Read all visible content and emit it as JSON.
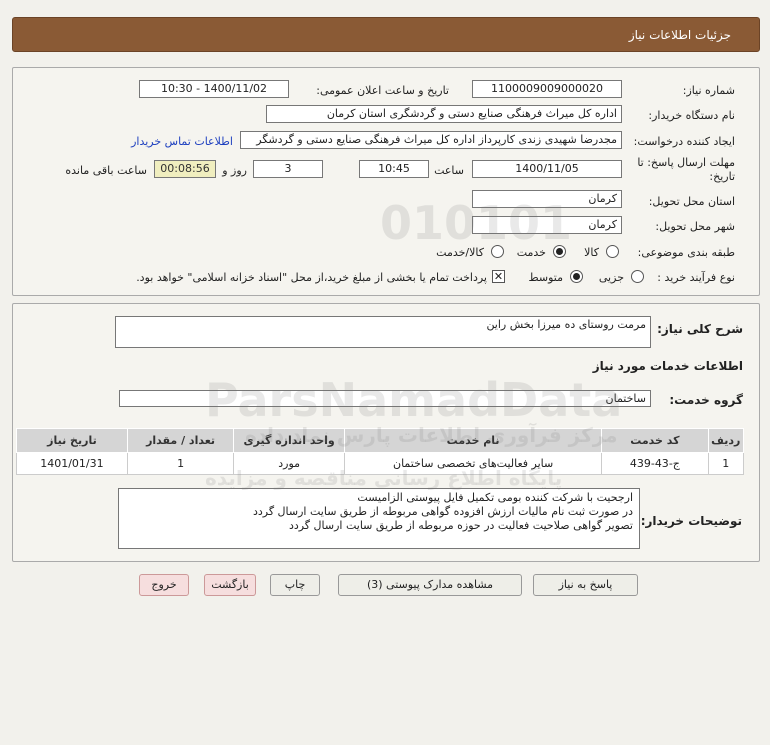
{
  "header": {
    "title": "جزئیات اطلاعات نیاز"
  },
  "form": {
    "need_number_label": "شماره نیاز:",
    "need_number": "1100009009000020",
    "announce_label": "تاریخ و ساعت اعلان عمومی:",
    "announce_value": "1400/11/02 - 10:30",
    "buyer_org_label": "نام دستگاه خریدار:",
    "buyer_org": "اداره کل میراث فرهنگی  صنایع دستی و گردشگری استان کرمان",
    "requester_label": "ایجاد کننده درخواست:",
    "requester": "مجدرضا شهیدی زندی کارپرداز اداره کل میراث فرهنگی  صنایع دستی و گردشگر",
    "contact_link": "اطلاعات تماس خریدار",
    "deadline_label_1": "مهلت ارسال پاسخ: تا",
    "deadline_label_2": "تاریخ:",
    "deadline_date": "1400/11/05",
    "time_label": "ساعت",
    "deadline_time": "10:45",
    "days_value": "3",
    "days_label": "روز و",
    "timer_value": "00:08:56",
    "remaining_label": "ساعت باقی مانده",
    "province_label": "استان محل تحویل:",
    "province": "کرمان",
    "city_label": "شهر محل تحویل:",
    "city": "کرمان",
    "category_label": "طبقه بندی موضوعی:",
    "category_options": [
      "کالا",
      "خدمت",
      "کالا/خدمت"
    ],
    "category_selected": "خدمت",
    "process_label": "نوع فرآیند خرید :",
    "process_options": [
      "جزیی",
      "متوسط"
    ],
    "process_selected": "متوسط",
    "payment_note": "پرداخت تمام یا بخشی از مبلغ خرید،از محل \"اسناد خزانه اسلامی\" خواهد بود."
  },
  "summary": {
    "desc_label": "شرح کلی نیاز:",
    "desc_value": "مرمت روستای ده میرزا بخش راین",
    "services_title": "اطلاعات خدمات مورد نیاز",
    "group_label": "گروه خدمت:",
    "group_value": "ساختمان",
    "table": {
      "headers": [
        "ردیف",
        "کد خدمت",
        "نام خدمت",
        "واحد اندازه گیری",
        "تعداد / مقدار",
        "تاریخ نیاز"
      ],
      "rows": [
        [
          "1",
          "ج-43-439",
          "سایر فعالیت‌های تخصصی ساختمان",
          "مورد",
          "1",
          "1401/01/31"
        ]
      ]
    },
    "buyer_notes_label": "توضیحات خریدار:",
    "buyer_notes": [
      "ارجحیت با شرکت کننده بومی تکمیل فایل پیوستی الزامیست",
      "در صورت ثبت نام مالیات ارزش افزوده گواهی مربوطه از طریق سایت ارسال گردد",
      "تصویر گواهی صلاحیت فعالیت در حوزه مربوطه از طریق سایت ارسال گردد"
    ]
  },
  "buttons": {
    "reply": "پاسخ به نیاز",
    "attachments": "مشاهده مدارک پیوستی (3)",
    "print": "چاپ",
    "back": "بازگشت",
    "exit": "خروج"
  },
  "watermark": {
    "brand": "ParsNamadData",
    "digits": "010101",
    "caption_1": "مرکز فرآوری اطلاعات پارس نماد داده",
    "caption_2": "پایگاه اطلاع رسانی مناقصه و مزایده"
  }
}
